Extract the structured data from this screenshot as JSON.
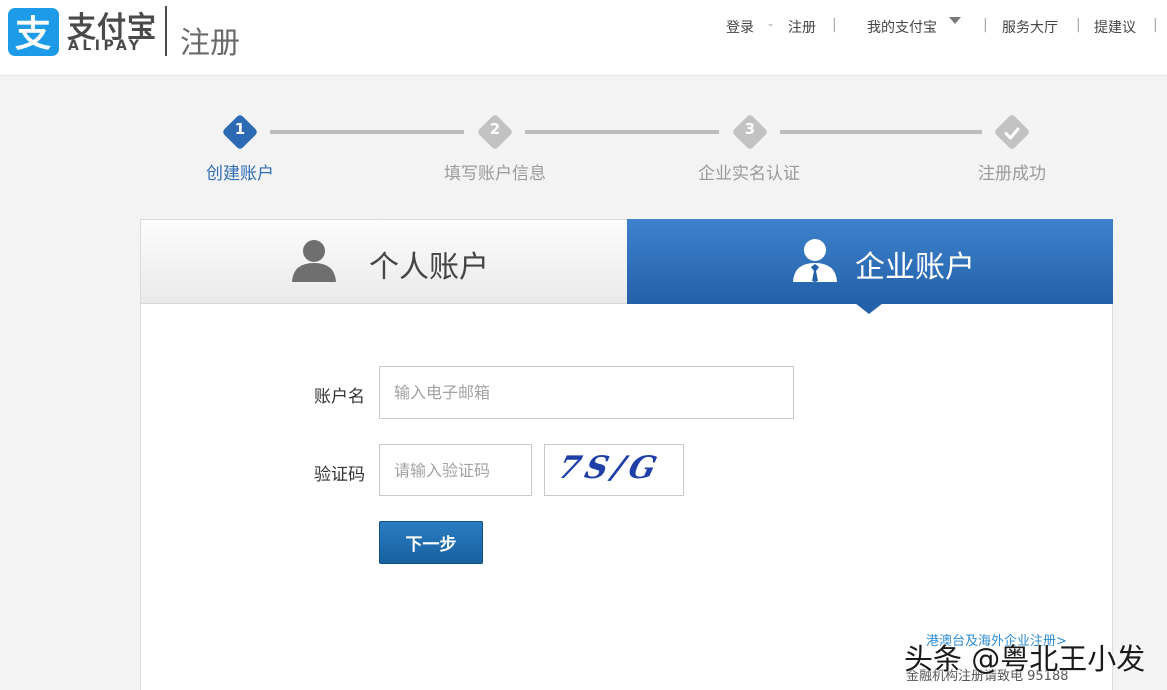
{
  "header": {
    "logo_cn": "支付宝",
    "logo_en": "ALIPAY",
    "logo_glyph": "支",
    "page_title": "注册",
    "nav": {
      "login": "登录",
      "dash": "-",
      "register": "注册",
      "my_alipay": "我的支付宝",
      "service_hall": "服务大厅",
      "feedback": "提建议",
      "separator": "|"
    }
  },
  "steps": [
    {
      "number": "1",
      "label": "创建账户",
      "state": "active"
    },
    {
      "number": "2",
      "label": "填写账户信息",
      "state": "inactive"
    },
    {
      "number": "3",
      "label": "企业实名认证",
      "state": "inactive"
    },
    {
      "number": "check-icon",
      "label": "注册成功",
      "state": "inactive"
    }
  ],
  "tabs": {
    "personal": {
      "label": "个人账户",
      "icon": "person-icon",
      "selected": false
    },
    "enterprise": {
      "label": "企业账户",
      "icon": "business-person-icon",
      "selected": true
    }
  },
  "form": {
    "account_label": "账户名",
    "account_placeholder": "输入电子邮箱",
    "account_value": "",
    "captcha_label": "验证码",
    "captcha_placeholder": "请输入验证码",
    "captcha_value": "",
    "captcha_image_text": "7S/G",
    "next_button": "下一步"
  },
  "footer": {
    "overseas_link": "港澳台及海外企业注册>",
    "finance_note": "金融机构注册请致电 95188"
  },
  "watermark": "头条 @粤北王小发",
  "colors": {
    "brand_blue": "#1e9be8",
    "active_step": "#2c6bb3",
    "tab_selected": "#2361a9",
    "button": "#17619f"
  }
}
